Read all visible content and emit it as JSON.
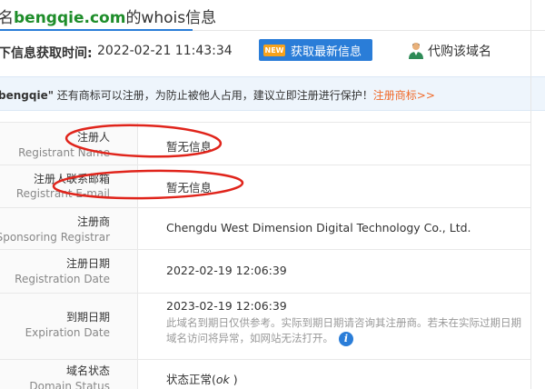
{
  "title": {
    "prefix": "名",
    "domain": "bengqie.com",
    "suffix": "的whois信息"
  },
  "info_bar": {
    "label": "下信息获取时间:",
    "time": "2022-02-21 11:43:34",
    "refresh_badge": "NEW",
    "refresh_label": "获取最新信息",
    "buy_label": "代购该域名",
    "buy_icon": "person-icon"
  },
  "notice": {
    "domain": "bengqie\"",
    "text": " 还有商标可以注册，为防止被他人占用，建议立即注册进行保护！",
    "link": "注册商标>>"
  },
  "rows": [
    {
      "label_cn": "注册人",
      "label_en": "Registrant Name",
      "value": "暂无信息"
    },
    {
      "label_cn": "注册人联系邮箱",
      "label_en": "Registrant E-mail",
      "value": "暂无信息"
    },
    {
      "label_cn": "注册商",
      "label_en": "Sponsoring Registrar",
      "value": "Chengdu West Dimension Digital Technology Co., Ltd."
    },
    {
      "label_cn": "注册日期",
      "label_en": "Registration Date",
      "value": "2022-02-19 12:06:39"
    },
    {
      "label_cn": "到期日期",
      "label_en": "Expiration Date",
      "value": "2023-02-19 12:06:39",
      "note_line1": "此域名到期日仅供参考。实际到期日期请咨询其注册商。若未在实际过期日期",
      "note_line2": "域名访问将异常，如网站无法打开。",
      "note_icon": "i"
    },
    {
      "label_cn": "域名状态",
      "label_en": "Domain Status",
      "value_prefix": "状态正常(",
      "value_status": "ok",
      "value_suffix": " )"
    }
  ],
  "colors": {
    "accent": "#2a7dd8",
    "domain_green": "#1e8d2a",
    "notice_link": "#f06a2a",
    "annotation_red": "#e0241b"
  }
}
